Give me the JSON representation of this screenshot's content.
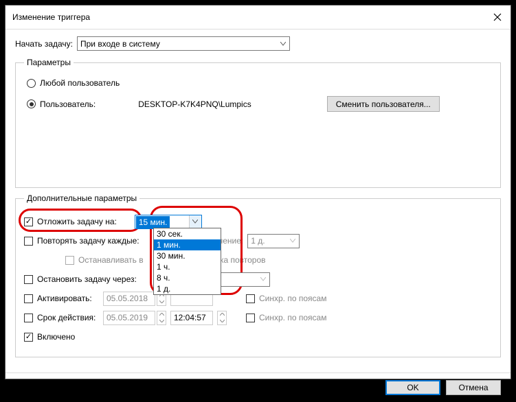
{
  "window": {
    "title": "Изменение триггера"
  },
  "begin": {
    "label": "Начать задачу:",
    "selected": "При входе в систему"
  },
  "params": {
    "legend": "Параметры",
    "any_user": "Любой пользователь",
    "specific_user": "Пользователь:",
    "user_value": "DESKTOP-K7K4PNQ\\Lumpics",
    "change_user": "Сменить пользователя..."
  },
  "adv": {
    "legend": "Дополнительные параметры",
    "delay_label": "Отложить задачу на:",
    "delay_selected": "15 мин.",
    "delay_options": [
      "30 сек.",
      "1 мин.",
      "30 мин.",
      "1 ч.",
      "8 ч.",
      "1 д."
    ],
    "delay_highlight": "1 мин.",
    "repeat_label": "Повторять задачу каждые:",
    "repeat_duration_label": "в течение:",
    "repeat_duration_value": "1 д.",
    "stop_at_end_label": "Останавливать в",
    "stop_at_end_suffix": "срока повторов",
    "stop_after_label": "Остановить задачу через:",
    "activate_label": "Активировать:",
    "activate_date": "05.05.2018",
    "expire_label": "Срок действия:",
    "expire_date": "05.05.2019",
    "expire_time": "12:04:57",
    "sync_tz": "Синхр. по поясам",
    "enabled_label": "Включено"
  },
  "footer": {
    "ok": "OK",
    "cancel": "Отмена"
  }
}
